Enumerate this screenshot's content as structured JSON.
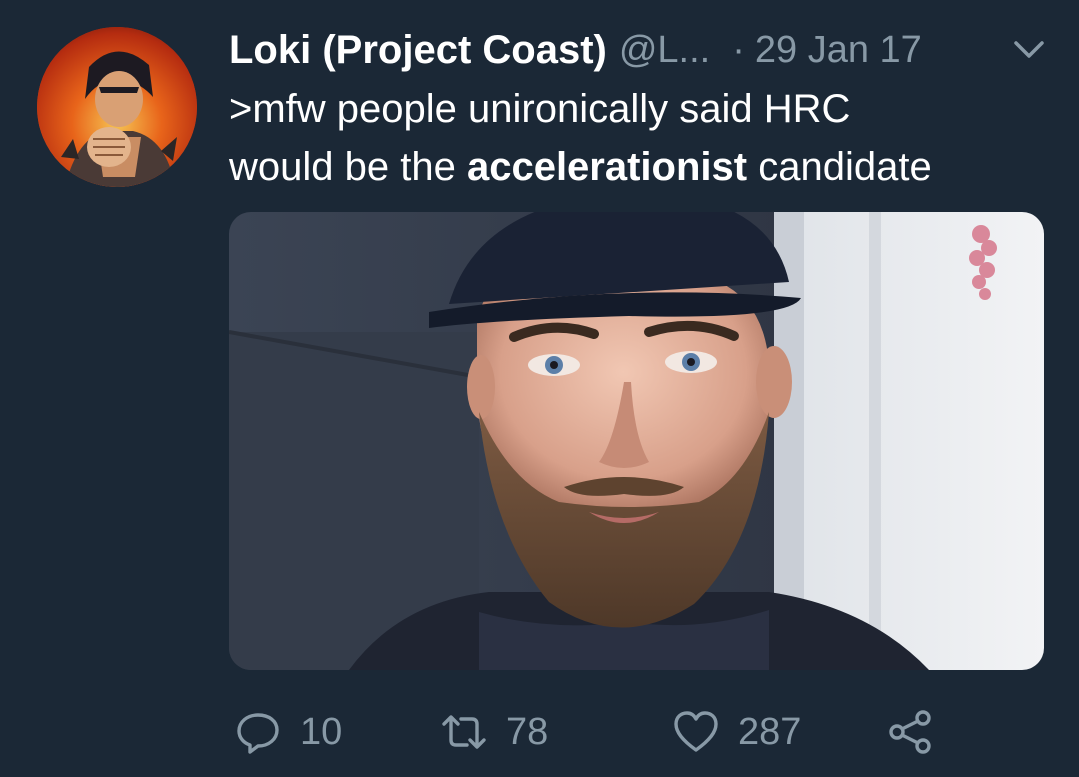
{
  "tweet": {
    "display_name": "Loki (Project Coast)",
    "handle": "@L...",
    "separator": "·",
    "date": "29 Jan 17",
    "text_line1": ">mfw people unironically said HRC",
    "text_line2_prefix": "would be the ",
    "text_line2_bold": "accelerationist",
    "text_line2_suffix": " candidate"
  },
  "actions": {
    "reply_count": "10",
    "retweet_count": "78",
    "like_count": "287"
  },
  "icons": {
    "avatar": "avatar-image",
    "caret": "chevron-down-icon",
    "reply": "reply-icon",
    "retweet": "retweet-icon",
    "like": "heart-icon",
    "share": "share-icon"
  },
  "colors": {
    "background": "#1b2836",
    "text": "#ffffff",
    "secondary": "#8899a6"
  }
}
